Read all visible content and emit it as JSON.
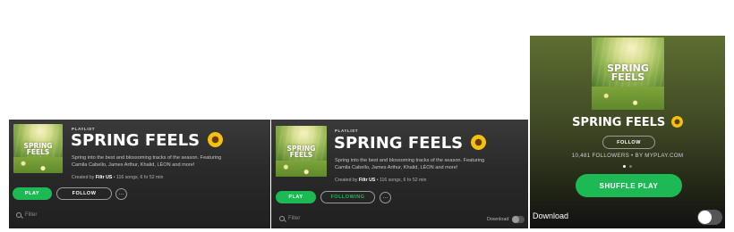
{
  "playlist": {
    "kind_label": "PLAYLIST",
    "title": "SPRING FEELS",
    "cover_title": "SPRING\nFEELS",
    "description": "Spring into the best and blossoming tracks of the season. Featuring Camila Cabello, James Arthur, Khalid, LÉON and more!",
    "created_by_prefix": "Created by",
    "creator": "Filtr US",
    "stats": "• 116 songs, 6 hr 52 min"
  },
  "desktop_view_1": {
    "play_label": "PLAY",
    "follow_label": "FOLLOW",
    "more_glyph": "···",
    "filter_placeholder": "Filter"
  },
  "desktop_view_2": {
    "play_label": "PLAY",
    "following_label": "FOLLOWING",
    "more_glyph": "···",
    "filter_placeholder": "Filter",
    "download_label": "Download"
  },
  "mobile_view": {
    "title": "SPRING FEELS",
    "follow_label": "FOLLOW",
    "followers_line": "10,481 FOLLOWERS • BY MYPLAY.COM",
    "carousel": {
      "pages": 2,
      "active": 1
    },
    "shuffle_label": "SHUFFLE PLAY",
    "download_label": "Download",
    "download_enabled": false
  },
  "colors": {
    "accent_green": "#1db954",
    "panel_dark": "#282828",
    "mobile_header_olive": "#5e6e31"
  },
  "icons": {
    "title_emoji": "sunflower-icon",
    "filter": "search-icon",
    "more": "more-options-icon"
  }
}
